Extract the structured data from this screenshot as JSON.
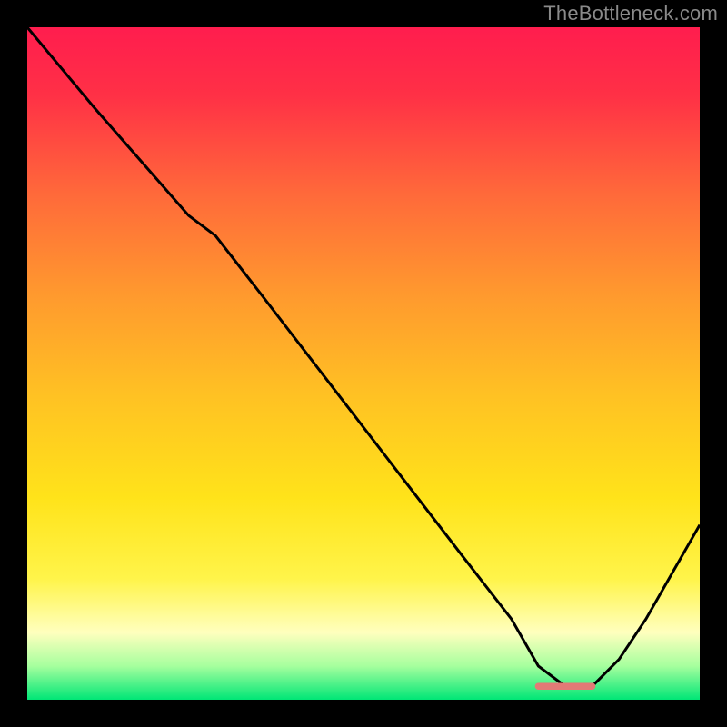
{
  "watermark": "TheBottleneck.com",
  "chart_data": {
    "type": "line",
    "title": "",
    "xlabel": "",
    "ylabel": "",
    "xlim": [
      0,
      100
    ],
    "ylim": [
      0,
      100
    ],
    "grid": false,
    "legend": false,
    "gradient_stops": [
      {
        "offset": 0.0,
        "color": "#ff1d4e"
      },
      {
        "offset": 0.1,
        "color": "#ff3046"
      },
      {
        "offset": 0.25,
        "color": "#ff6a3a"
      },
      {
        "offset": 0.4,
        "color": "#ff9a2e"
      },
      {
        "offset": 0.55,
        "color": "#ffc223"
      },
      {
        "offset": 0.7,
        "color": "#ffe31a"
      },
      {
        "offset": 0.82,
        "color": "#fff44a"
      },
      {
        "offset": 0.9,
        "color": "#ffffbe"
      },
      {
        "offset": 0.95,
        "color": "#a6ff9e"
      },
      {
        "offset": 1.0,
        "color": "#00e676"
      }
    ],
    "series": [
      {
        "name": "bottleneck-curve",
        "stroke": "#000000",
        "stroke_width": 3,
        "x": [
          0,
          5,
          10,
          17,
          24,
          28,
          35,
          45,
          55,
          65,
          72,
          76,
          80,
          84,
          88,
          92,
          96,
          100
        ],
        "values": [
          100,
          94,
          88,
          80,
          72,
          69,
          60,
          47,
          34,
          21,
          12,
          5,
          2,
          2,
          6,
          12,
          19,
          26
        ]
      }
    ],
    "marker": {
      "x_start": 76,
      "x_end": 84,
      "y": 2,
      "color": "#e37a76",
      "thickness": 2.5
    }
  }
}
